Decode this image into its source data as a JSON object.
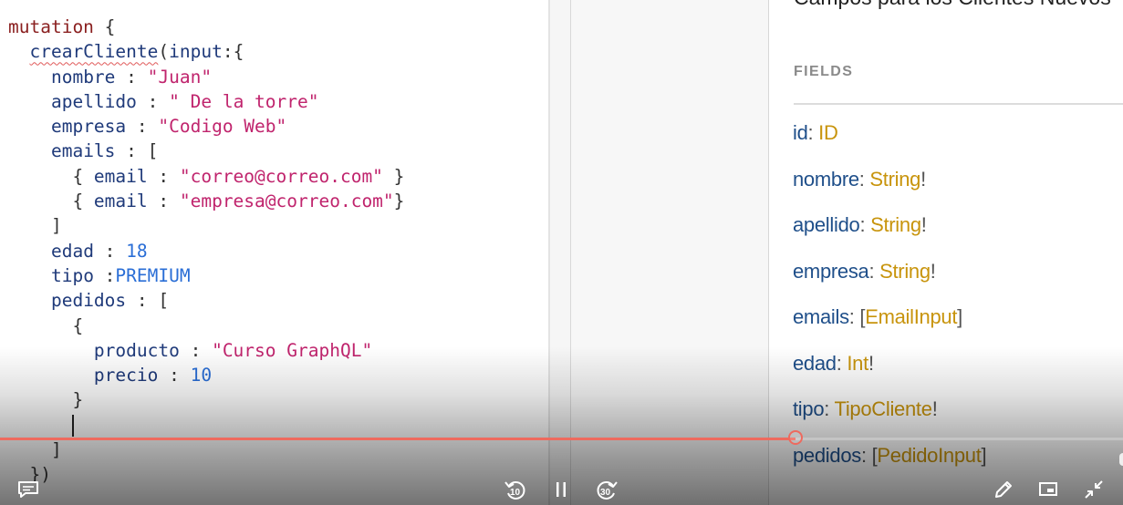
{
  "editor": {
    "lines": [
      [
        {
          "t": "mutation",
          "c": "kw"
        },
        {
          "t": " {",
          "c": "punc"
        }
      ],
      [
        {
          "t": "  ",
          "c": "punc"
        },
        {
          "t": "crearCliente",
          "c": "fn"
        },
        {
          "t": "(",
          "c": "punc"
        },
        {
          "t": "input",
          "c": "prop"
        },
        {
          "t": ":{",
          "c": "punc"
        }
      ],
      [
        {
          "t": "    ",
          "c": "punc"
        },
        {
          "t": "nombre",
          "c": "prop"
        },
        {
          "t": " : ",
          "c": "punc"
        },
        {
          "t": "\"Juan\"",
          "c": "str"
        }
      ],
      [
        {
          "t": "    ",
          "c": "punc"
        },
        {
          "t": "apellido",
          "c": "prop"
        },
        {
          "t": " : ",
          "c": "punc"
        },
        {
          "t": "\" De la torre\"",
          "c": "str"
        }
      ],
      [
        {
          "t": "    ",
          "c": "punc"
        },
        {
          "t": "empresa",
          "c": "prop"
        },
        {
          "t": " : ",
          "c": "punc"
        },
        {
          "t": "\"Codigo Web\"",
          "c": "str"
        }
      ],
      [
        {
          "t": "    ",
          "c": "punc"
        },
        {
          "t": "emails",
          "c": "prop"
        },
        {
          "t": " : [",
          "c": "punc"
        }
      ],
      [
        {
          "t": "      { ",
          "c": "punc"
        },
        {
          "t": "email",
          "c": "prop"
        },
        {
          "t": " : ",
          "c": "punc"
        },
        {
          "t": "\"correo@correo.com\"",
          "c": "str"
        },
        {
          "t": " }",
          "c": "punc"
        }
      ],
      [
        {
          "t": "      { ",
          "c": "punc"
        },
        {
          "t": "email",
          "c": "prop"
        },
        {
          "t": " : ",
          "c": "punc"
        },
        {
          "t": "\"empresa@correo.com\"",
          "c": "str"
        },
        {
          "t": "}",
          "c": "punc"
        }
      ],
      [
        {
          "t": "    ]",
          "c": "punc"
        }
      ],
      [
        {
          "t": "    ",
          "c": "punc"
        },
        {
          "t": "edad",
          "c": "prop"
        },
        {
          "t": " : ",
          "c": "punc"
        },
        {
          "t": "18",
          "c": "num"
        }
      ],
      [
        {
          "t": "    ",
          "c": "punc"
        },
        {
          "t": "tipo",
          "c": "prop"
        },
        {
          "t": " :",
          "c": "punc"
        },
        {
          "t": "PREMIUM",
          "c": "enum"
        }
      ],
      [
        {
          "t": "    ",
          "c": "punc"
        },
        {
          "t": "pedidos",
          "c": "prop"
        },
        {
          "t": " : [",
          "c": "punc"
        }
      ],
      [
        {
          "t": "      {",
          "c": "punc"
        }
      ],
      [
        {
          "t": "        ",
          "c": "punc"
        },
        {
          "t": "producto",
          "c": "prop"
        },
        {
          "t": " : ",
          "c": "punc"
        },
        {
          "t": "\"Curso GraphQL\"",
          "c": "str"
        }
      ],
      [
        {
          "t": "        ",
          "c": "punc"
        },
        {
          "t": "precio",
          "c": "prop"
        },
        {
          "t": " : ",
          "c": "punc"
        },
        {
          "t": "10",
          "c": "num"
        }
      ],
      [
        {
          "t": "      }",
          "c": "punc"
        }
      ],
      [
        {
          "t": "      ",
          "c": "punc"
        },
        {
          "t": "",
          "c": "caret"
        }
      ],
      [
        {
          "t": "    ]",
          "c": "punc"
        }
      ],
      [
        {
          "t": "  })",
          "c": "punc"
        }
      ]
    ]
  },
  "docs": {
    "description": "Campos para los Clientes Nuevos",
    "fields_heading": "FIELDS",
    "fields": [
      {
        "name": "id",
        "type": "ID",
        "open": "",
        "close": "",
        "bang": ""
      },
      {
        "name": "nombre",
        "type": "String",
        "open": "",
        "close": "",
        "bang": "!"
      },
      {
        "name": "apellido",
        "type": "String",
        "open": "",
        "close": "",
        "bang": "!"
      },
      {
        "name": "empresa",
        "type": "String",
        "open": "",
        "close": "",
        "bang": "!"
      },
      {
        "name": "emails",
        "type": "EmailInput",
        "open": "[",
        "close": "]",
        "bang": ""
      },
      {
        "name": "edad",
        "type": "Int",
        "open": "",
        "close": "",
        "bang": "!"
      },
      {
        "name": "tipo",
        "type": "TipoCliente",
        "open": "",
        "close": "",
        "bang": "!"
      },
      {
        "name": "pedidos",
        "type": "PedidoInput",
        "open": "[",
        "close": "]",
        "bang": ""
      }
    ]
  },
  "player": {
    "progress": 0.708,
    "rewind_seconds": "10",
    "forward_seconds": "30",
    "colors": {
      "progress": "#ee6a5e"
    },
    "icons": [
      "captions-icon",
      "rewind-10-icon",
      "pause-icon",
      "forward-30-icon",
      "annotate-pen-icon",
      "picture-in-picture-icon",
      "exit-fullscreen-icon"
    ]
  }
}
